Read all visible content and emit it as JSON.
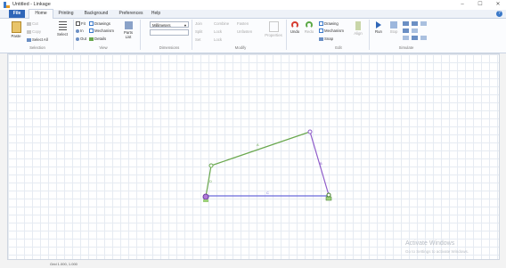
{
  "window": {
    "title": "Untitled - Linkage",
    "minimize": "–",
    "maximize": "☐",
    "close": "✕"
  },
  "tabs": [
    "File",
    "Home",
    "Printing",
    "Background",
    "Preferences",
    "Help"
  ],
  "help_icon": "?",
  "ribbon": {
    "selection": {
      "label": "Selection",
      "paste": "Paste",
      "cut": "Cut",
      "copy": "Copy",
      "select_all": "Select All",
      "select": "Select"
    },
    "view": {
      "label": "View",
      "fit": "Fit",
      "in": "In",
      "out": "Out",
      "drawings": "Drawings",
      "mechanism": "Mechanism",
      "details": "Details",
      "parts_list": "Parts List"
    },
    "dimensions": {
      "label": "Dimensions",
      "unit": "Millimeters"
    },
    "modify": {
      "label": "Modify",
      "items": [
        "Join",
        "Combine",
        "Fasten",
        "Split",
        "Lock",
        "Unfasten",
        "Set",
        "Lock",
        "Properties"
      ]
    },
    "edit": {
      "label": "Edit",
      "undo": "Undo",
      "redo": "Redo",
      "drawing": "Drawing",
      "mechanism": "Mechanism",
      "snap": "Snap",
      "align": "Align"
    },
    "simulate": {
      "label": "Simulate",
      "run": "Run",
      "stop": "Stop"
    }
  },
  "mechanism": {
    "links": [
      {
        "label": "A",
        "color": "#6aa84f"
      },
      {
        "label": "B",
        "color": "#8e5bc9"
      },
      {
        "label": "C",
        "color": "#6a6ad9"
      },
      {
        "label": "D",
        "color": "#6aa84f"
      }
    ]
  },
  "status": {
    "text": "Grid 1.000, 1.000"
  },
  "watermark": {
    "line1": "Activate Windows",
    "line2": "Go to Settings to activate Windows."
  },
  "colors": {
    "accent": "#2f66b8",
    "ground_link": "#6a6ad9",
    "green_link": "#6aa84f",
    "purple_link": "#8e5bc9"
  }
}
